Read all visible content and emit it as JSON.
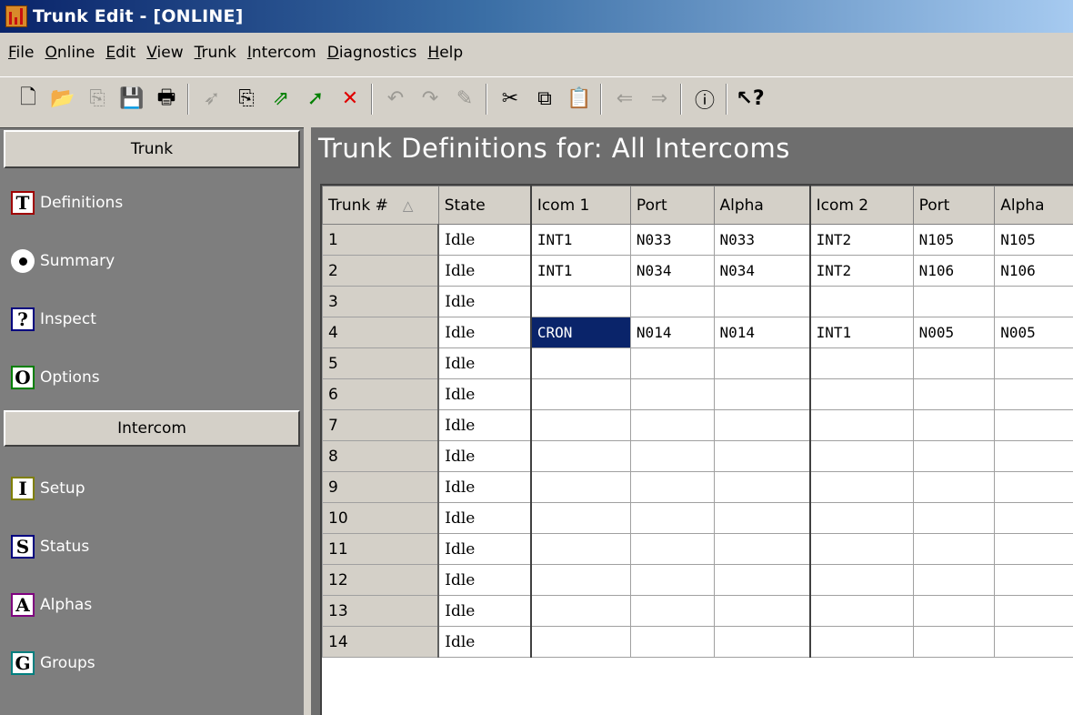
{
  "window": {
    "title": "Trunk Edit - [ONLINE]"
  },
  "menu": [
    {
      "label": "File",
      "u": "F",
      "rest": "ile"
    },
    {
      "label": "Online",
      "u": "O",
      "rest": "nline"
    },
    {
      "label": "Edit",
      "u": "E",
      "rest": "dit"
    },
    {
      "label": "View",
      "u": "V",
      "rest": "iew"
    },
    {
      "label": "Trunk",
      "u": "T",
      "rest": "runk"
    },
    {
      "label": "Intercom",
      "u": "I",
      "rest": "ntercom"
    },
    {
      "label": "Diagnostics",
      "u": "D",
      "rest": "iagnostics"
    },
    {
      "label": "Help",
      "u": "H",
      "rest": "elp"
    }
  ],
  "toolbar_icons": [
    "new-file-icon",
    "open-folder-icon",
    "copy-page-icon",
    "save-icon",
    "print-icon",
    "send-icon",
    "copy-page-icon",
    "upload-icon",
    "arrow-icon",
    "delete-icon",
    "undo-icon",
    "redo-icon",
    "eraser-icon",
    "cut-icon",
    "copy-icon",
    "paste-icon",
    "back-icon",
    "forward-icon",
    "info-icon",
    "help-pointer-icon"
  ],
  "sidebar": {
    "trunk_header": "Trunk",
    "trunk_items": [
      {
        "icon": "T",
        "label": "Definitions",
        "color": "#a00000"
      },
      {
        "icon": "dot",
        "label": "Summary",
        "color": "#000000"
      },
      {
        "icon": "?",
        "label": "Inspect",
        "color": "#00007f"
      },
      {
        "icon": "O",
        "label": "Options",
        "color": "#007f00"
      }
    ],
    "intercom_header": "Intercom",
    "intercom_items": [
      {
        "icon": "I",
        "label": "Setup",
        "color": "#7f7f00"
      },
      {
        "icon": "S",
        "label": "Status",
        "color": "#00007f"
      },
      {
        "icon": "A",
        "label": "Alphas",
        "color": "#7f007f"
      },
      {
        "icon": "G",
        "label": "Groups",
        "color": "#007f7f"
      }
    ]
  },
  "main": {
    "title": "Trunk Definitions for:  All Intercoms",
    "columns": [
      "Trunk #",
      "State",
      "Icom 1",
      "Port",
      "Alpha",
      "Icom 2",
      "Port",
      "Alpha"
    ],
    "sort_indicator": "△",
    "rows": [
      [
        "1",
        "Idle",
        "INT1",
        "N033",
        "N033",
        "INT2",
        "N105",
        "N105"
      ],
      [
        "2",
        "Idle",
        "INT1",
        "N034",
        "N034",
        "INT2",
        "N106",
        "N106"
      ],
      [
        "3",
        "Idle",
        "",
        "",
        "",
        "",
        "",
        ""
      ],
      [
        "4",
        "Idle",
        "CRON",
        "N014",
        "N014",
        "INT1",
        "N005",
        "N005"
      ],
      [
        "5",
        "Idle",
        "",
        "",
        "",
        "",
        "",
        ""
      ],
      [
        "6",
        "Idle",
        "",
        "",
        "",
        "",
        "",
        ""
      ],
      [
        "7",
        "Idle",
        "",
        "",
        "",
        "",
        "",
        ""
      ],
      [
        "8",
        "Idle",
        "",
        "",
        "",
        "",
        "",
        ""
      ],
      [
        "9",
        "Idle",
        "",
        "",
        "",
        "",
        "",
        ""
      ],
      [
        "10",
        "Idle",
        "",
        "",
        "",
        "",
        "",
        ""
      ],
      [
        "11",
        "Idle",
        "",
        "",
        "",
        "",
        "",
        ""
      ],
      [
        "12",
        "Idle",
        "",
        "",
        "",
        "",
        "",
        ""
      ],
      [
        "13",
        "Idle",
        "",
        "",
        "",
        "",
        "",
        ""
      ],
      [
        "14",
        "Idle",
        "",
        "",
        "",
        "",
        "",
        ""
      ]
    ],
    "selected_cell": {
      "row": 3,
      "col": 2
    }
  }
}
